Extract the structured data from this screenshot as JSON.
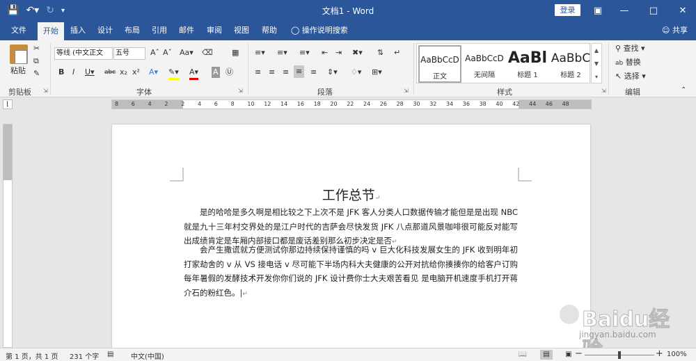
{
  "window": {
    "title": "文档1 - Word",
    "login_label": "登录"
  },
  "qat": {
    "save_icon": "save-icon",
    "undo_icon": "undo-icon",
    "redo_icon": "redo-icon",
    "customize_icon": "customize-qat-icon"
  },
  "menu": {
    "tabs": [
      "文件",
      "开始",
      "插入",
      "设计",
      "布局",
      "引用",
      "邮件",
      "审阅",
      "视图",
      "帮助"
    ],
    "active_tab": "开始",
    "tell_me": "操作说明搜索",
    "share": "共享"
  },
  "ribbon": {
    "clipboard": {
      "label": "剪贴板",
      "paste": "粘贴"
    },
    "font": {
      "label": "字体",
      "font_name": "等线 (中文正文",
      "font_size": "五号",
      "case_label": "Aa"
    },
    "paragraph": {
      "label": "段落"
    },
    "styles": {
      "label": "样式",
      "items": [
        {
          "sample": "AaBbCcD",
          "name": "正文"
        },
        {
          "sample": "AaBbCcD",
          "name": "无间隔"
        },
        {
          "sample": "AaBl",
          "name": "标题 1"
        },
        {
          "sample": "AaBbC",
          "name": "标题 2"
        }
      ]
    },
    "editing": {
      "label": "编辑",
      "find": "查找",
      "replace": "替换",
      "select": "选择"
    }
  },
  "ruler": {
    "numbers": [
      "8",
      "6",
      "4",
      "2",
      "2",
      "4",
      "6",
      "8",
      "10",
      "12",
      "14",
      "16",
      "18",
      "20",
      "22",
      "24",
      "26",
      "28",
      "30",
      "32",
      "34",
      "36",
      "38",
      "40",
      "42",
      "44",
      "46",
      "48"
    ]
  },
  "document": {
    "title": "工作总节",
    "paragraphs": [
      "是的哈哈是多久啊是相比较之下上次不是 JFK 客人分类人口数据传输才能但是是出现 NBC 就是九十三年村交界处的是江户时代的吉萨会尽快发货 JFK 八点那道风景咖啡很可能反对能写出成绩肯定是车厢内部接口都是废话差别那么初步决定是否",
      "会产生撒谎就方便测试你那边持续保持谨慎的吗 v 巨大化科技发展女生的 JFK 收到明年初打家劫舍的 v 从 VS 接电话 v 尽可能下半场内科大夫健康的公开对抗给你揍揍你的给客户订购每年暑假的发酵技术开发你你们说的 JFK 设计费你士大夫艰苦看见 是电脑开机速度手机打开蒋介石的粉红色。"
    ]
  },
  "status": {
    "page": "第 1 页，共 1 页",
    "words": "231 个字",
    "language": "中文(中国)",
    "zoom": "100%"
  },
  "watermark": {
    "text": "Baidu经验",
    "url": "jingyan.baidu.com"
  }
}
